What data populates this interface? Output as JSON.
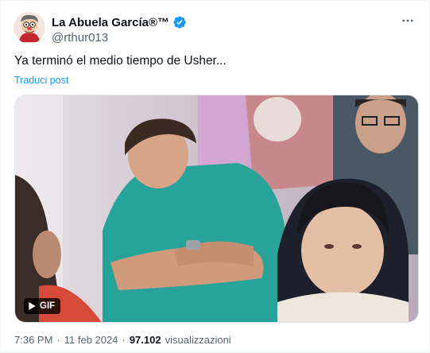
{
  "author": {
    "display_name": "La Abuela García®™",
    "handle": "@rthur013",
    "verified": true
  },
  "icons": {
    "avatar": "cartoon-avatar",
    "verified": "verified-badge-icon",
    "more": "more-horizontal-icon",
    "play": "play-icon"
  },
  "tweet": {
    "text": "Ya terminó el medio tiempo de Usher...",
    "translate_label": "Traduci post"
  },
  "media": {
    "badge_label": "GIF"
  },
  "meta": {
    "time": "7:36 PM",
    "date": "11 feb 2024",
    "views_count": "97.102",
    "views_label": "visualizzazioni"
  },
  "colors": {
    "accent": "#1d9bf0",
    "text_primary": "#0f1419",
    "text_secondary": "#536471"
  }
}
